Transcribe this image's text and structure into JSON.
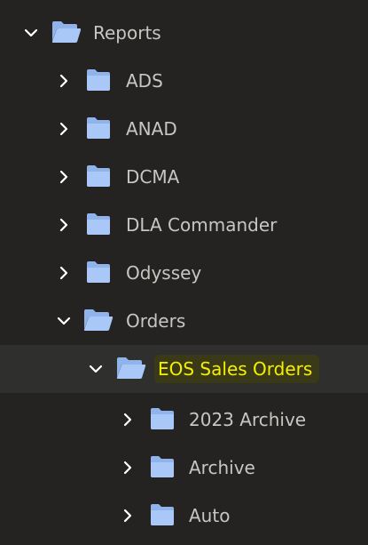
{
  "tree": {
    "items": [
      {
        "label": "Reports",
        "expanded": true,
        "icon": "folder-open-icon"
      },
      {
        "label": "ADS",
        "expanded": false,
        "icon": "folder-icon"
      },
      {
        "label": "ANAD",
        "expanded": false,
        "icon": "folder-icon"
      },
      {
        "label": "DCMA",
        "expanded": false,
        "icon": "folder-icon"
      },
      {
        "label": "DLA Commander",
        "expanded": false,
        "icon": "folder-icon"
      },
      {
        "label": "Odyssey",
        "expanded": false,
        "icon": "folder-icon"
      },
      {
        "label": "Orders",
        "expanded": true,
        "icon": "folder-open-icon"
      },
      {
        "label": "EOS Sales Orders",
        "expanded": true,
        "selected": true,
        "icon": "folder-open-icon"
      },
      {
        "label": "2023 Archive",
        "expanded": false,
        "icon": "folder-icon"
      },
      {
        "label": "Archive",
        "expanded": false,
        "icon": "folder-icon"
      },
      {
        "label": "Auto",
        "expanded": false,
        "icon": "folder-icon"
      }
    ]
  },
  "colors": {
    "background": "#242322",
    "selected_row": "#2f2f2e",
    "text": "#c8c6c2",
    "highlight_text": "#f4f000",
    "highlight_bg": "#3a3a18",
    "folder": "#a9c8f7",
    "chevron": "#ffffff"
  }
}
